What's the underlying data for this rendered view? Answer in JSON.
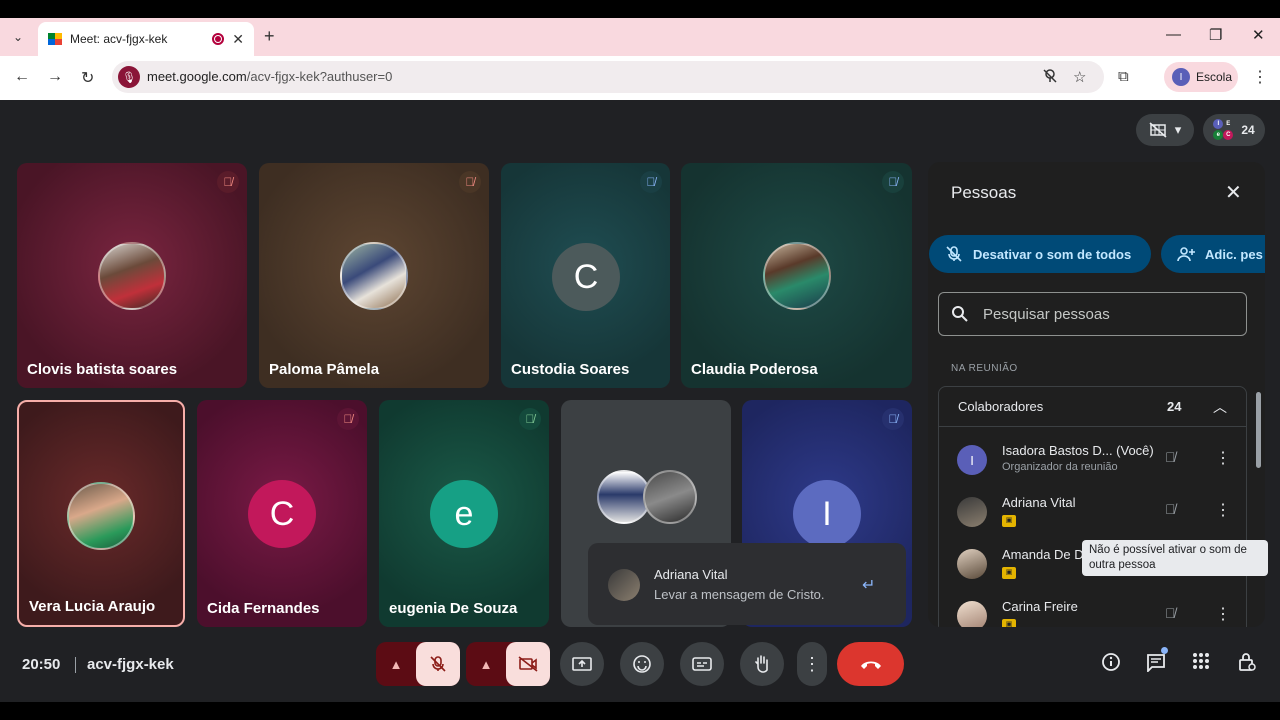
{
  "browser": {
    "tab_title": "Meet: acv-fjgx-kek",
    "url_host": "meet.google.com",
    "url_path": "/acv-fjgx-kek?authuser=0",
    "profile_label": "Escola",
    "profile_initial": "I"
  },
  "meet": {
    "participant_count": "24",
    "tiles": [
      {
        "name": "Clovis batista soares",
        "type": "photo"
      },
      {
        "name": "Paloma Pâmela",
        "type": "photo"
      },
      {
        "name": "Custodia Soares",
        "type": "letter",
        "letter": "C"
      },
      {
        "name": "Claudia Poderosa",
        "type": "photo"
      },
      {
        "name": "Vera Lucia Araujo",
        "type": "photo"
      },
      {
        "name": "Cida Fernandes",
        "type": "letter",
        "letter": "C"
      },
      {
        "name": "eugenia De Souza",
        "type": "letter",
        "letter": "e"
      },
      {
        "name": "",
        "type": "group"
      },
      {
        "name": "",
        "type": "letter",
        "letter": "I"
      }
    ],
    "notification": {
      "sender": "Adriana Vital",
      "message": "Levar a mensagem de Cristo."
    },
    "clock": "20:50",
    "meeting_code": "acv-fjgx-kek"
  },
  "people_panel": {
    "title": "Pessoas",
    "mute_all_label": "Desativar o som de todos",
    "add_people_label": "Adic. pes",
    "search_placeholder": "Pesquisar pessoas",
    "section_label": "NA REUNIÃO",
    "group_name": "Colaboradores",
    "group_count": "24",
    "people": [
      {
        "name": "Isadora Bastos D... (Você)",
        "subtitle": "Organizador da reunião",
        "initial": "I"
      },
      {
        "name": "Adriana Vital",
        "subtitle": ""
      },
      {
        "name": "Amanda De D",
        "subtitle": ""
      },
      {
        "name": "Carina Freire",
        "subtitle": ""
      }
    ],
    "tooltip": "Não é possível ativar o som de outra pessoa"
  },
  "colors": {
    "meet_bg": "#202124",
    "panel_bg": "#1f1f1f",
    "end_call": "#dc362e",
    "pill_bg": "#004a77",
    "chrome_tint": "#f9d9df"
  }
}
